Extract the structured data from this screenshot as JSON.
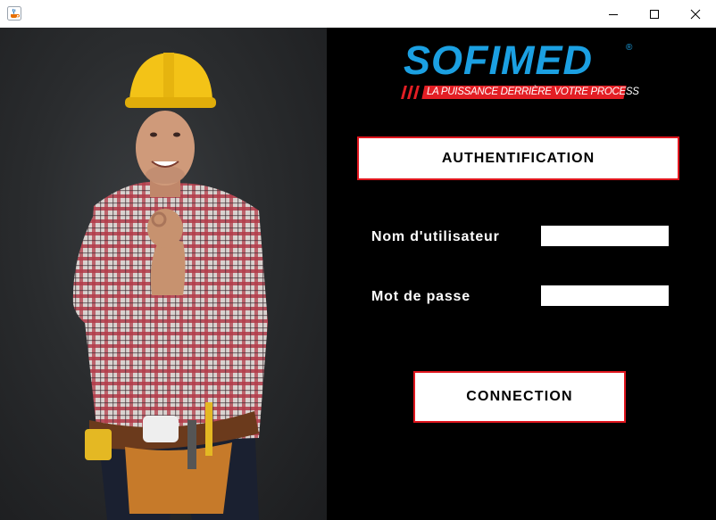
{
  "window": {
    "title": "",
    "app_icon": "java-cup-icon",
    "controls": {
      "minimize": "minimize-icon",
      "maximize": "maximize-icon",
      "close": "close-icon"
    }
  },
  "photo": {
    "subject": "construction-worker-photo"
  },
  "logo": {
    "name": "SOFIMED",
    "registered": "®",
    "tagline": "LA PUISSANCE DERRIÈRE VOTRE PROCESS",
    "colors": {
      "brand": "#1ba0e2",
      "accent": "#e31e24"
    }
  },
  "auth": {
    "title": "AUTHENTIFICATION"
  },
  "form": {
    "username_label": "Nom d'utilisateur",
    "username_value": "",
    "password_label": "Mot de passe",
    "password_value": ""
  },
  "connect_label": "CONNECTION",
  "colors": {
    "background": "#000000",
    "border_accent": "#e0161e"
  }
}
